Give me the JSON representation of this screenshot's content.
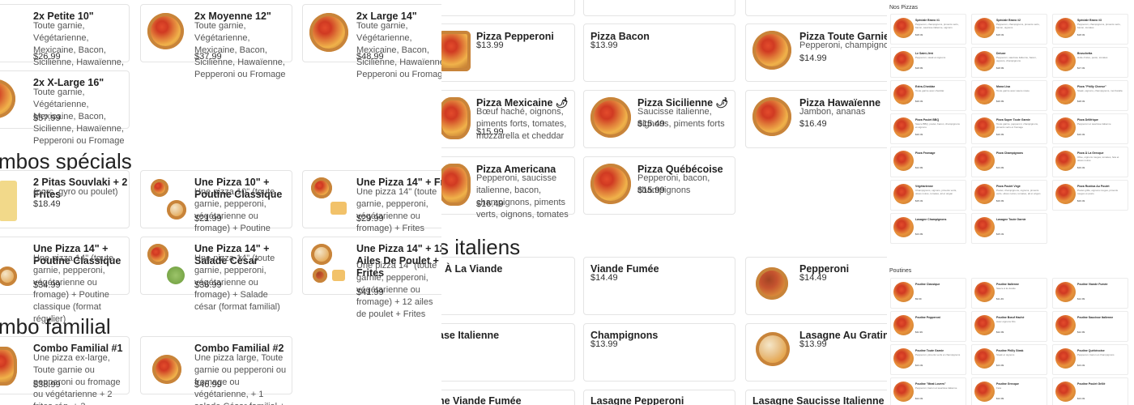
{
  "panel1": {
    "combos_top": [
      {
        "title": "2x Petite 10\"",
        "desc": "Toute garnie, Végétarienne, Mexicaine, Bacon, Sicilienne, Hawaïenne, Pepperoni ou Fromage",
        "price": "$26.99"
      },
      {
        "title": "2x Moyenne 12\"",
        "desc": "Toute garnie, Végétarienne, Mexicaine, Bacon, Sicilienne, Hawaïenne, Pepperoni ou Fromage",
        "price": "$37.99"
      },
      {
        "title": "2x Large 14\"",
        "desc": "Toute garnie, Végétarienne, Mexicaine, Bacon, Sicilienne, Hawaïenne, Pepperoni ou Fromage",
        "price": "$48.99"
      },
      {
        "title": "2x X-Large 16\"",
        "desc": "Toute garnie, Végétarienne, Mexicaine, Bacon, Sicilienne, Hawaïenne, Pepperoni ou Fromage",
        "price": "$57.99"
      }
    ],
    "section_special": "mbos spécials",
    "specials": [
      {
        "title": "2 Pitas Souvlaki + 2 Frites",
        "desc": "(porc, gyro ou poulet)",
        "price": "$18.49"
      },
      {
        "title": "Une Pizza 10\" + Poutine Classique",
        "desc": "Une pizza 10\" (toute garnie, pepperoni, végétarienne ou fromage) + Poutine classique (format régulier)",
        "price": "$21.99"
      },
      {
        "title": "Une Pizza 14\" + Frites",
        "desc": "Une pizza 14\" (toute garnie, pepperoni, végétarienne ou fromage) + Frites (format familial)",
        "price": "$29.99"
      },
      {
        "title": "Une Pizza 14\" + Poutine Classique",
        "desc": "Une pizza 14\" (toute garnie, pepperoni, végétarienne ou fromage) + Poutine classique (format régulier)",
        "price": "$34.99"
      },
      {
        "title": "Une Pizza 14\" + Salade César",
        "desc": "Une pizza 14\" (toute garnie, pepperoni, végétarienne ou fromage) + Salade césar (format familial)",
        "price": "$36.99"
      },
      {
        "title": "Une Pizza 14\" + 12 Ailes De Poulet + Frites",
        "desc": "Une pizza 14\" (toute garnie, pepperoni, végétarienne ou fromage) + 12 ailes de poulet + Frites",
        "price": "$41.99"
      }
    ],
    "section_family": "mbo familial",
    "family": [
      {
        "title": "Combo Familial #1",
        "desc": "Une pizza ex-large, Toute garnie ou pepperoni ou fromage ou végétarienne + 2 frites rég. + 3 breuvages.",
        "price": "$38.99"
      },
      {
        "title": "Combo Familial #2",
        "desc": "Une pizza large, Toute garnie ou pepperoni ou fromage ou végétarienne, + 1 salade César familial + 1 frites familial.",
        "price": "$46.99"
      }
    ]
  },
  "panel2": {
    "pizzas": [
      {
        "title": "Pizza Pepperoni",
        "desc": "",
        "price": "$13.99"
      },
      {
        "title": "Pizza Bacon",
        "desc": "",
        "price": "$13.99"
      },
      {
        "title": "Pizza Toute Garnie",
        "desc": "Pepperoni, champignons, piments verts",
        "price": "$14.99"
      },
      {
        "title": "Pizza Mexicaine 🌶",
        "desc": "Bœuf haché, oignons, piments forts, tomates, mozzarella et cheddar",
        "price": "$15.99"
      },
      {
        "title": "Pizza Sicilienne 🌶",
        "desc": "Saucisse italienne, oignons, piments forts",
        "price": "$15.49"
      },
      {
        "title": "Pizza Hawaïenne",
        "desc": "Jambon, ananas",
        "price": "$16.49"
      },
      {
        "title": "Pizza Americana",
        "desc": "Pepperoni, saucisse italienne, bacon, champignons, piments verts, oignons, tomates",
        "price": "$16.49"
      },
      {
        "title": "Pizza Québécoise",
        "desc": "Pepperoni, bacon, champignons",
        "price": "$15.99"
      }
    ],
    "section_pasta": "s italiens",
    "pasta": [
      {
        "title": "À La Viande",
        "price": ""
      },
      {
        "title": "Viande Fumée",
        "price": "$14.49"
      },
      {
        "title": "Pepperoni",
        "price": "$14.49"
      },
      {
        "title": "ase Italienne",
        "price": ""
      },
      {
        "title": "Champignons",
        "price": "$13.99"
      },
      {
        "title": "Lasagne Au Gratin",
        "price": "$13.99"
      },
      {
        "title": "ne Viande Fumée",
        "price": ""
      },
      {
        "title": "Lasagne Pepperoni",
        "price": ""
      },
      {
        "title": "Lasagne Saucisse Italienne",
        "price": ""
      }
    ]
  },
  "panel3": {
    "heading_pizzas": "Nos Pizzas",
    "heading_poutines": "Poutines",
    "pizzas": [
      {
        "title": "Spéciale Bravo #1",
        "desc": "Pepperoni, champignons, piments verts, bacon, saucisse italienne, oignons",
        "price": "$18.49"
      },
      {
        "title": "Spéciale Bravo #2",
        "desc": "Pepperoni, champignons, piments verts, bacon, oignons",
        "price": "$18.49"
      },
      {
        "title": "Spéciale Bravo #3",
        "desc": "Pepperoni, champignons, piments verts, bacon, tomates",
        "price": "$18.49"
      },
      {
        "title": "Le Saint-Jérô",
        "desc": "Pepperoni, steak et oignons",
        "price": "$18.99"
      },
      {
        "title": "Deluxe",
        "desc": "Pepperoni, saucisse italienne, bacon, oignons, champignons",
        "price": "$18.99"
      },
      {
        "title": "Bruschetta",
        "desc": "Huile d'olive, pesto, tomates",
        "price": "$17.49"
      },
      {
        "title": "Extra-Cheddar",
        "desc": "Toute garnie avec cheddar",
        "price": "$16.49"
      },
      {
        "title": "Mona Lisa",
        "desc": "Toute garnie avec sauce rosée",
        "price": "$16.99"
      },
      {
        "title": "Pizza \"Philly Cheese\"",
        "desc": "Steak, oignons, champignons, mozzarella",
        "price": "$18.49"
      },
      {
        "title": "Pizza Poulet BBQ",
        "desc": "Sauce BBQ, poulet, bacon, champignons et oignons",
        "price": "$16.49"
      },
      {
        "title": "Pizza Super Toute Garnie",
        "desc": "Toute garnie, pepperoni, champignons, piments verts et fromage",
        "price": "$16.99"
      },
      {
        "title": "Pizza Délifrique",
        "desc": "Pepperoni et saucisse italienne",
        "price": "$16.49"
      },
      {
        "title": "Pizza Fromage",
        "desc": "",
        "price": "$12.99"
      },
      {
        "title": "Pizza Champignons",
        "desc": "",
        "price": "$13.99"
      },
      {
        "title": "Pizza À La Grecque",
        "desc": "Olive, oignons rouges, tomates, feta et olives noires",
        "price": "$16.49"
      },
      {
        "title": "Végétarienne",
        "desc": "Champignons, oignons, piments verts, olives noires, tomates, ail et origan",
        "price": "$15.49"
      },
      {
        "title": "Pizza Poulet Végé",
        "desc": "Poulet, champignons, oignons, piments verts, olives noires, tomates, ail et origan",
        "price": "$16.99"
      },
      {
        "title": "Pizza Rustica Au Poulet",
        "desc": "Poulet grillé, oignons rouges, piments rouges et pesto",
        "price": "$16.49"
      },
      {
        "title": "Lasagne Champignons",
        "desc": "",
        "price": "$13.99"
      },
      {
        "title": "Lasagne Toute Garnie",
        "desc": "",
        "price": "$15.49"
      }
    ],
    "poutines": [
      {
        "title": "Poutine Classique",
        "desc": "",
        "price": "$9.99"
      },
      {
        "title": "Poutine Italienne",
        "desc": "Sauce à la viande",
        "price": "$11.49"
      },
      {
        "title": "Poutine Viande Fumée",
        "desc": "",
        "price": "$12.99"
      },
      {
        "title": "Poutine Pepperoni",
        "desc": "",
        "price": "$11.99"
      },
      {
        "title": "Poutine Bœuf Haché",
        "desc": "Avec oignons frits",
        "price": "$12.99"
      },
      {
        "title": "Poutine Saucisse Italienne",
        "desc": "",
        "price": "$12.99"
      },
      {
        "title": "Poutine Toute Garnie",
        "desc": "Pepperoni, piments verts et champignons",
        "price": "$13.49"
      },
      {
        "title": "Poutine Philly Steak",
        "desc": "Steak et oignons",
        "price": "$13.99"
      },
      {
        "title": "Poutine Québécoise",
        "desc": "Pepperoni, bacon et champignons",
        "price": "$13.49"
      },
      {
        "title": "Poutine \"Meat Lovers\"",
        "desc": "Pepperoni, bacon et saucisse italienne",
        "price": "$14.49"
      },
      {
        "title": "Poutine Grecque",
        "desc": "Feta",
        "price": "$12.99"
      },
      {
        "title": "Poutine Poulet Grillé",
        "desc": "",
        "price": "$13.49"
      }
    ]
  }
}
